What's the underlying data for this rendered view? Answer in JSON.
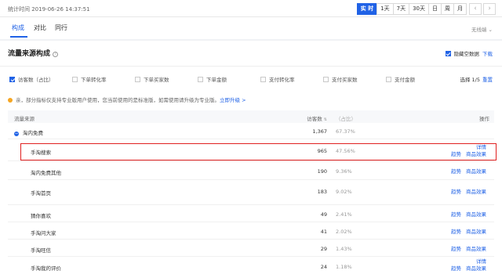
{
  "topbar": {
    "stat_time": "统计时间 2019-06-26 14:37:51",
    "ranges": [
      "实 时",
      "1天",
      "7天",
      "30天",
      "日",
      "周",
      "月"
    ],
    "active_range": "实 时",
    "prev_icon": "chevron-left-icon",
    "next_icon": "chevron-right-icon"
  },
  "tabs": [
    {
      "label": "构成",
      "active": true
    },
    {
      "label": "对比",
      "active": false
    },
    {
      "label": "同行",
      "active": false
    }
  ],
  "no_filter": "无线端 ⌄",
  "panel": {
    "title": "流量来源构成",
    "hide_zero_label": "隐藏空数据",
    "hide_zero_checked": true,
    "download_label": "下载"
  },
  "metrics": [
    {
      "label": "访客数（占比）",
      "checked": true
    },
    {
      "label": "下单转化率",
      "checked": false
    },
    {
      "label": "下单买家数",
      "checked": false
    },
    {
      "label": "下单金额",
      "checked": false
    },
    {
      "label": "支付转化率",
      "checked": false
    },
    {
      "label": "支付买家数",
      "checked": false
    },
    {
      "label": "支付金额",
      "checked": false
    }
  ],
  "metric_select": {
    "count": "选择 1/5",
    "reset": "重置"
  },
  "notice": {
    "text": "亲，部分指标仅支持专业版用户使用，您当前使用的是标准版，如需使用请升级为专业版。",
    "link": "立即升级 >"
  },
  "table": {
    "headers": {
      "source": "流量来源",
      "visits": "访客数",
      "pct": "（占比）",
      "ops": "操作"
    },
    "rows": [
      {
        "source": "淘内免费",
        "visits": "1,367",
        "pct": "67.37%",
        "ops": [],
        "level": 0
      },
      {
        "source": "手淘搜索",
        "visits": "965",
        "pct": "47.56%",
        "ops": [
          "详情",
          "趋势",
          "商品效果"
        ],
        "level": 1
      },
      {
        "source": "淘内免费其他",
        "visits": "190",
        "pct": "9.36%",
        "ops": [
          "趋势",
          "商品效果"
        ],
        "level": 1
      },
      {
        "source": "手淘首页",
        "visits": "183",
        "pct": "9.02%",
        "ops": [
          "趋势",
          "商品效果"
        ],
        "level": 1
      },
      {
        "source": "猜你喜欢",
        "visits": "49",
        "pct": "2.41%",
        "ops": [
          "趋势",
          "商品效果"
        ],
        "level": 1
      },
      {
        "source": "手淘问大家",
        "visits": "41",
        "pct": "2.02%",
        "ops": [
          "趋势",
          "商品效果"
        ],
        "level": 1
      },
      {
        "source": "手淘旺信",
        "visits": "29",
        "pct": "1.43%",
        "ops": [
          "趋势",
          "商品效果"
        ],
        "level": 1
      },
      {
        "source": "手淘我的评价",
        "visits": "24",
        "pct": "1.18%",
        "ops": [
          "详情",
          "趋势",
          "商品效果"
        ],
        "level": 1
      }
    ]
  },
  "colors": {
    "accent": "#2062e6",
    "highlight": "#e02020",
    "notice_dot": "#f5a623"
  }
}
